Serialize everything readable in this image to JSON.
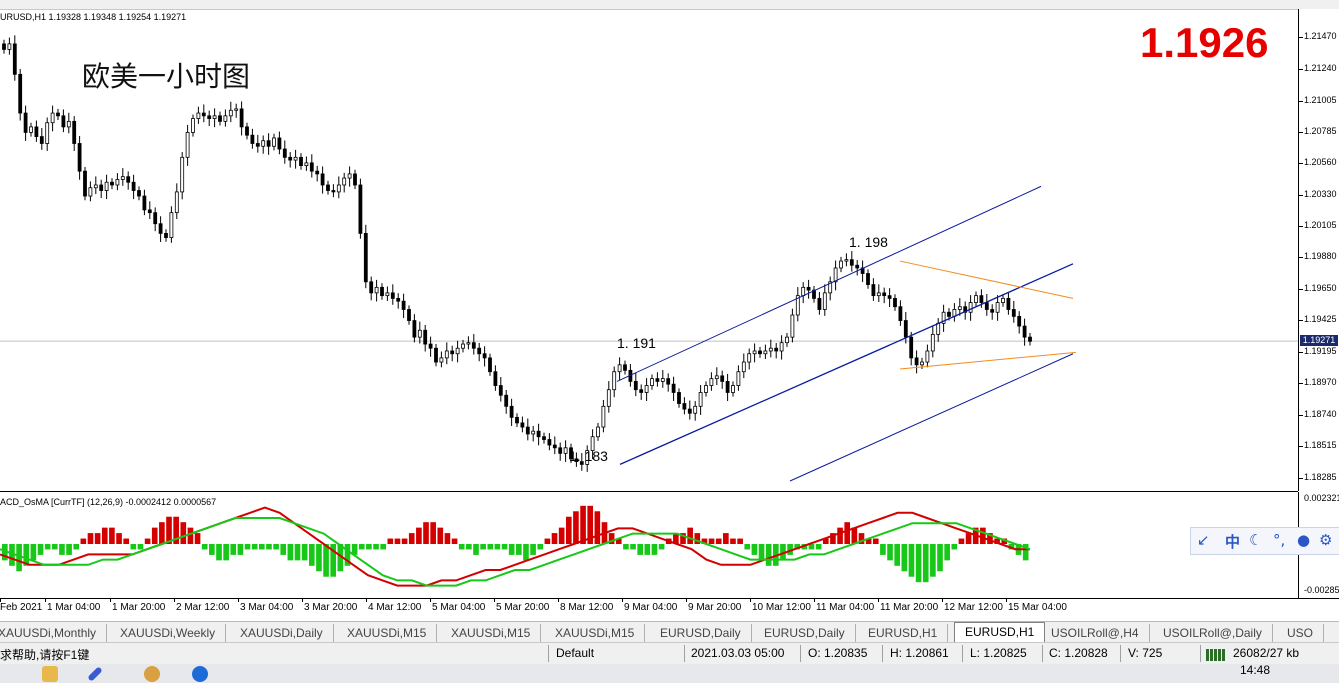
{
  "symbol_info": "URUSD,H1  1.19328 1.19348 1.19254 1.19271",
  "chart_title": "欧美一小时图",
  "big_price": "1.1926",
  "current_price_tag": "1.19271",
  "annotations": [
    {
      "text": "1. 198",
      "x": "11 Mar 04:00",
      "y": 1.1985
    },
    {
      "text": "1. 191",
      "x": "9 Mar 04:00",
      "y": 1.1914
    },
    {
      "text": "1. 183",
      "x": "8 Mar 12:00",
      "y": 1.1835
    }
  ],
  "osc_info": "ACD_OsMA [CurrTF] (12,26,9) -0.0002412 0.0000567",
  "osc_axis": {
    "top": "0.002321",
    "bottom": "-0.002859"
  },
  "chart_data": {
    "type": "candlestick",
    "title": "欧美一小时图",
    "symbol": "EURUSD",
    "timeframe": "H1",
    "ylim": [
      1.1826,
      1.216
    ],
    "y_ticks": [
      "1.21470",
      "1.21240",
      "1.21005",
      "1.20785",
      "1.20560",
      "1.20330",
      "1.20105",
      "1.19880",
      "1.19650",
      "1.19425",
      "1.19195",
      "1.18970",
      "1.18740",
      "1.18515",
      "1.18285"
    ],
    "x_ticks": [
      "Feb 2021",
      "1 Mar 04:00",
      "1 Mar 20:00",
      "2 Mar 12:00",
      "3 Mar 04:00",
      "3 Mar 20:00",
      "4 Mar 12:00",
      "5 Mar 04:00",
      "5 Mar 20:00",
      "8 Mar 12:00",
      "9 Mar 04:00",
      "9 Mar 20:00",
      "10 Mar 12:00",
      "11 Mar 04:00",
      "11 Mar 20:00",
      "12 Mar 12:00",
      "15 Mar 04:00"
    ],
    "close_series": [
      1.2138,
      1.2142,
      1.212,
      1.2092,
      1.2078,
      1.2082,
      1.2075,
      1.207,
      1.2085,
      1.2092,
      1.209,
      1.2082,
      1.2086,
      1.207,
      1.205,
      1.2032,
      1.2038,
      1.204,
      1.2036,
      1.2042,
      1.204,
      1.2044,
      1.2046,
      1.2042,
      1.2036,
      1.2032,
      1.2022,
      1.202,
      1.2012,
      1.2005,
      1.2002,
      1.202,
      1.2035,
      1.206,
      1.2078,
      1.2088,
      1.2092,
      1.209,
      1.2088,
      1.209,
      1.2086,
      1.209,
      1.2094,
      1.2095,
      1.2082,
      1.2076,
      1.207,
      1.2068,
      1.2072,
      1.2068,
      1.2074,
      1.2066,
      1.206,
      1.2058,
      1.206,
      1.2054,
      1.2056,
      1.205,
      1.2048,
      1.204,
      1.2036,
      1.2035,
      1.204,
      1.2045,
      1.2048,
      1.204,
      1.2005,
      1.197,
      1.1962,
      1.1966,
      1.196,
      1.1962,
      1.1958,
      1.1956,
      1.195,
      1.1942,
      1.193,
      1.1935,
      1.1925,
      1.1922,
      1.1912,
      1.1915,
      1.192,
      1.1918,
      1.1922,
      1.1925,
      1.1926,
      1.1922,
      1.1918,
      1.1915,
      1.1905,
      1.1895,
      1.1888,
      1.188,
      1.1872,
      1.1868,
      1.1865,
      1.186,
      1.1862,
      1.1858,
      1.1856,
      1.1852,
      1.185,
      1.1846,
      1.185,
      1.1842,
      1.184,
      1.1838,
      1.1848,
      1.1858,
      1.1865,
      1.188,
      1.1892,
      1.1905,
      1.191,
      1.1906,
      1.1898,
      1.1892,
      1.189,
      1.1895,
      1.19,
      1.1898,
      1.19,
      1.1896,
      1.189,
      1.1882,
      1.1878,
      1.1875,
      1.188,
      1.189,
      1.1895,
      1.19,
      1.1902,
      1.1898,
      1.189,
      1.1895,
      1.1905,
      1.1912,
      1.1918,
      1.192,
      1.1918,
      1.192,
      1.1922,
      1.192,
      1.1926,
      1.193,
      1.1946,
      1.196,
      1.1966,
      1.1964,
      1.1958,
      1.195,
      1.1962,
      1.197,
      1.198,
      1.1985,
      1.1986,
      1.1982,
      1.198,
      1.1976,
      1.1968,
      1.196,
      1.1962,
      1.196,
      1.1958,
      1.1952,
      1.1942,
      1.193,
      1.1915,
      1.191,
      1.1912,
      1.192,
      1.1932,
      1.194,
      1.1948,
      1.1945,
      1.195,
      1.1952,
      1.1948,
      1.1955,
      1.196,
      1.1955,
      1.195,
      1.1948,
      1.1955,
      1.1958,
      1.195,
      1.1945,
      1.1938,
      1.193,
      1.1927
    ]
  },
  "oscillator": {
    "name": "ACD_OsMA",
    "histogram": [
      -3,
      -4,
      -5,
      -4,
      -3,
      -2,
      -1,
      -1,
      -2,
      -2,
      -1,
      1,
      2,
      2,
      3,
      3,
      2,
      1,
      -1,
      -1,
      1,
      3,
      4,
      5,
      5,
      4,
      3,
      2,
      -1,
      -2,
      -3,
      -3,
      -2,
      -2,
      -1,
      -1,
      -1,
      -1,
      -1,
      -2,
      -3,
      -3,
      -3,
      -4,
      -5,
      -6,
      -6,
      -5,
      -4,
      -2,
      -1,
      -1,
      -1,
      -1,
      1,
      1,
      1,
      2,
      3,
      4,
      4,
      3,
      2,
      1,
      -1,
      -1,
      -2,
      -1,
      -1,
      -1,
      -1,
      -2,
      -2,
      -3,
      -2,
      -1,
      1,
      2,
      3,
      5,
      6,
      7,
      7,
      6,
      4,
      2,
      1,
      -1,
      -1,
      -2,
      -2,
      -2,
      -1,
      1,
      2,
      2,
      3,
      2,
      1,
      1,
      1,
      2,
      1,
      1,
      -1,
      -2,
      -3,
      -4,
      -4,
      -3,
      -2,
      -1,
      -1,
      -1,
      -1,
      1,
      2,
      3,
      4,
      3,
      2,
      1,
      1,
      -2,
      -3,
      -4,
      -5,
      -6,
      -7,
      -7,
      -6,
      -5,
      -3,
      -1,
      1,
      2,
      3,
      3,
      2,
      1,
      1,
      -1,
      -2,
      -3
    ],
    "signal_red": [
      -2,
      -3,
      -4,
      -4,
      -4,
      -3,
      -2,
      -2,
      -2,
      -2,
      -1,
      0,
      1,
      2,
      3,
      4,
      5,
      6,
      7,
      6,
      4,
      2,
      0,
      -2,
      -4,
      -6,
      -7,
      -8,
      -8,
      -8,
      -7,
      -7,
      -6,
      -5,
      -5,
      -4,
      -3,
      -2,
      -1,
      0,
      1,
      2,
      3,
      3,
      2,
      1,
      0,
      -1,
      -3,
      -4,
      -4,
      -4,
      -3,
      -2,
      -1,
      0,
      1,
      2,
      3,
      4,
      5,
      6,
      6,
      5,
      4,
      3,
      2,
      1,
      0,
      -1,
      -1
    ],
    "signal_green": [
      -1,
      -2,
      -3,
      -4,
      -4,
      -4,
      -4,
      -3,
      -3,
      -2,
      -1,
      0,
      1,
      2,
      3,
      4,
      5,
      5,
      5,
      5,
      4,
      3,
      2,
      0,
      -2,
      -4,
      -6,
      -7,
      -7,
      -8,
      -8,
      -8,
      -7,
      -7,
      -6,
      -5,
      -5,
      -4,
      -3,
      -2,
      -1,
      0,
      1,
      2,
      2,
      2,
      2,
      1,
      0,
      -1,
      -2,
      -3,
      -3,
      -3,
      -3,
      -2,
      -2,
      -1,
      0,
      1,
      2,
      3,
      4,
      4,
      4,
      4,
      3,
      2,
      1,
      0,
      -1
    ]
  },
  "colors": {
    "channel": "#0a1a9e",
    "triangle": "#f08c1e",
    "osc_red": "#d40000",
    "osc_green": "#18c818",
    "big_price": "#e60000"
  },
  "tabs": [
    "XAUUSDi,Monthly",
    "XAUUSDi,Weekly",
    "XAUUSDi,Daily",
    "XAUUSDi,M15",
    "XAUUSDi,M15",
    "XAUUSDi,M15",
    "EURUSD,Daily",
    "EURUSD,Daily",
    "EURUSD,H1",
    "EURUSD,H1",
    "USOILRoll@,H4",
    "USOILRoll@,Daily",
    "USO"
  ],
  "active_tab_index": 9,
  "status": {
    "help": "求帮助,请按F1键",
    "profile": "Default",
    "datetime": "2021.03.03 05:00",
    "open": "O: 1.20835",
    "high": "H: 1.20861",
    "low": "L: 1.20825",
    "close": "C: 1.20828",
    "volume": "V: 725",
    "traffic": "26082/27 kb"
  },
  "taskbar": {
    "clock": "14:48"
  },
  "widget": {
    "items": [
      "pencil-icon",
      "中",
      "moon-icon",
      "punctuation-icon",
      "user-icon",
      "gear-icon"
    ]
  }
}
